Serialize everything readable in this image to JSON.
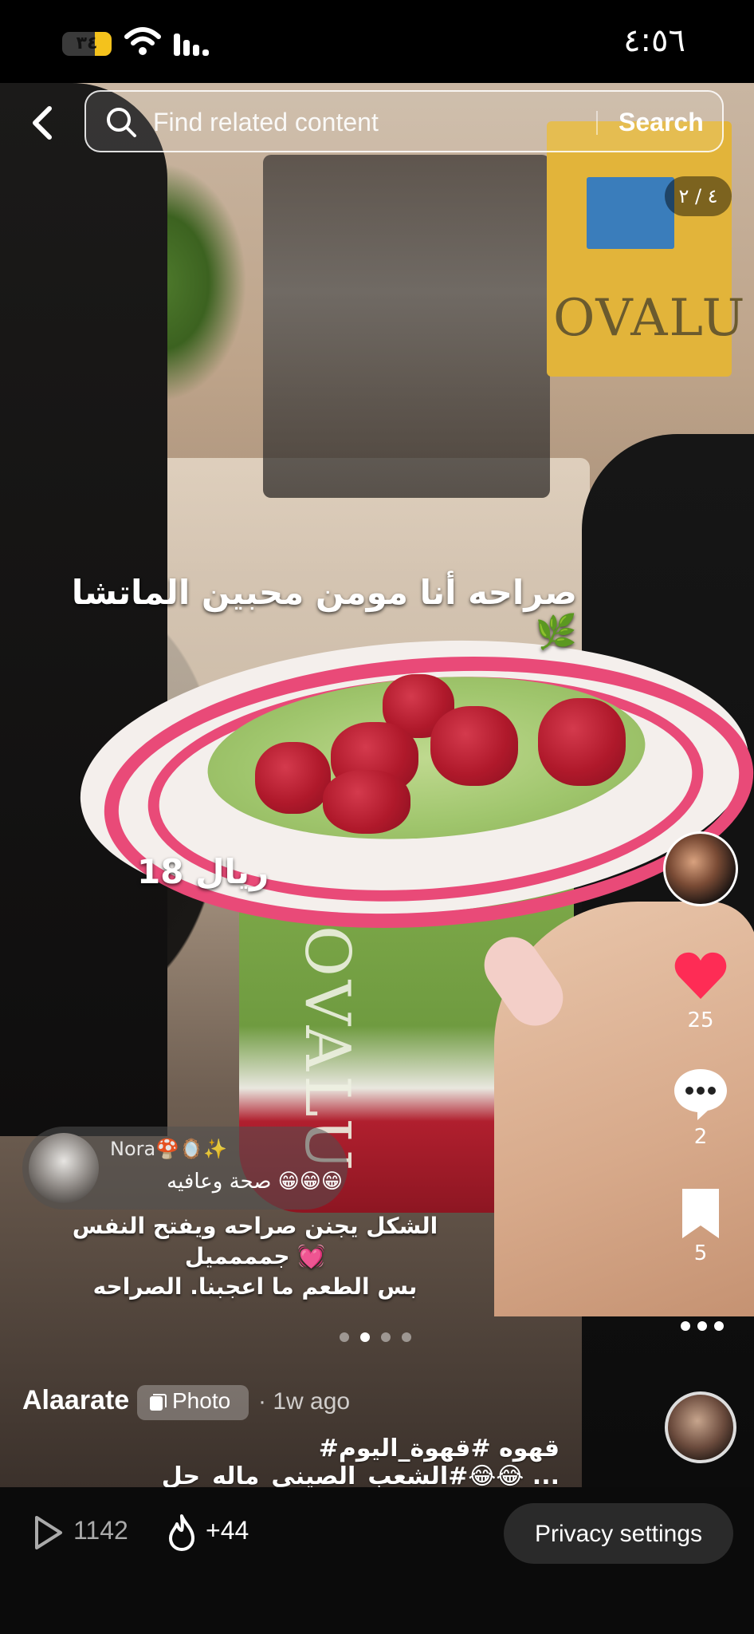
{
  "status_bar": {
    "battery": "٣٤",
    "battery_level": 0.34,
    "time": "٤:٥٦",
    "icons": [
      "wifi-icon",
      "signal-icon"
    ]
  },
  "search": {
    "placeholder": "Find related content",
    "button_label": "Search",
    "icon": "search-icon"
  },
  "back_icon": "back-chevron-icon",
  "pager": "٤ / ٢",
  "overlay": {
    "title": "صراحه أنا مومن محبين الماتشا 🌿",
    "price": "18 ريال"
  },
  "right_rail": {
    "likes": "25",
    "comments": "2",
    "saves": "5",
    "like_color": "#fe2c55"
  },
  "comment": {
    "name": "Nora🍄🪞✨",
    "text": "صحة وعافيه 😁😁😁"
  },
  "caption": "الشكل يجنن صراحه ويفتح النفس جمممميل 💓\nبس الطعم ما اعجبنا. الصراحه",
  "carousel": {
    "count": 4,
    "active": 1
  },
  "post": {
    "author": "Alaarate",
    "type_label": "Photo",
    "age": "· 1w ago",
    "hashtags": "#قهوه #قهوة_اليوم #الشعب_الصيني_ماله_حل😂😂 ..."
  },
  "bottom_bar": {
    "views": "1142",
    "boost": "+44",
    "privacy_label": "Privacy settings"
  }
}
